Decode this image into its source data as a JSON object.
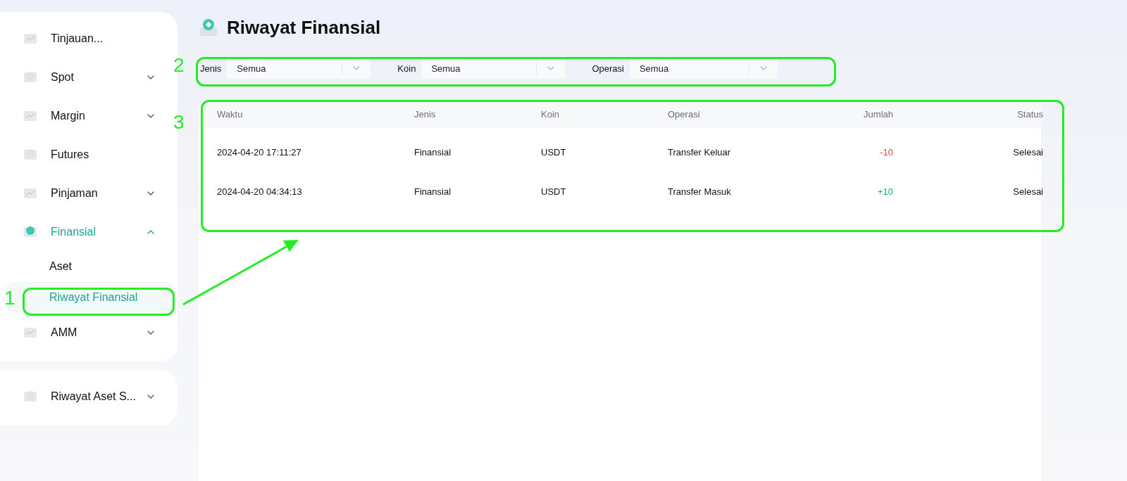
{
  "sidebar": {
    "groups": [
      {
        "items": [
          {
            "label": "Tinjauan...",
            "kind": "link",
            "selected": false
          },
          {
            "label": "Spot",
            "kind": "menu",
            "selected": false,
            "expanded": false
          },
          {
            "label": "Margin",
            "kind": "menu",
            "selected": false,
            "expanded": false
          },
          {
            "label": "Futures",
            "kind": "link",
            "selected": false
          },
          {
            "label": "Pinjaman",
            "kind": "menu",
            "selected": false,
            "expanded": false
          },
          {
            "label": "Finansial",
            "kind": "menu",
            "selected": true,
            "expanded": true,
            "children": [
              {
                "label": "Aset",
                "selected": false
              },
              {
                "label": "Riwayat Finansial",
                "selected": true
              }
            ]
          },
          {
            "label": "AMM",
            "kind": "menu",
            "selected": false,
            "expanded": false
          }
        ]
      },
      {
        "items": [
          {
            "label": "Riwayat Aset S...",
            "kind": "menu",
            "selected": false,
            "expanded": false
          }
        ]
      }
    ]
  },
  "page": {
    "title": "Riwayat Finansial"
  },
  "filters": [
    {
      "label": "Jenis",
      "value": "Semua"
    },
    {
      "label": "Koin",
      "value": "Semua"
    },
    {
      "label": "Operasi",
      "value": "Semua"
    }
  ],
  "table": {
    "columns": [
      "Waktu",
      "Jenis",
      "Koin",
      "Operasi",
      "Jumlah",
      "Status"
    ],
    "rows": [
      {
        "cells": [
          "2024-04-20 17:11:27",
          "Finansial",
          "USDT",
          "Transfer Keluar",
          "-10",
          "Selesai"
        ],
        "kind": "negative"
      },
      {
        "cells": [
          "2024-04-20 04:34:13",
          "Finansial",
          "USDT",
          "Transfer Masuk",
          "+10",
          "Selesai"
        ],
        "kind": "positive"
      }
    ]
  },
  "annotations": [
    {
      "label": "1"
    },
    {
      "label": "2"
    },
    {
      "label": "3"
    }
  ]
}
